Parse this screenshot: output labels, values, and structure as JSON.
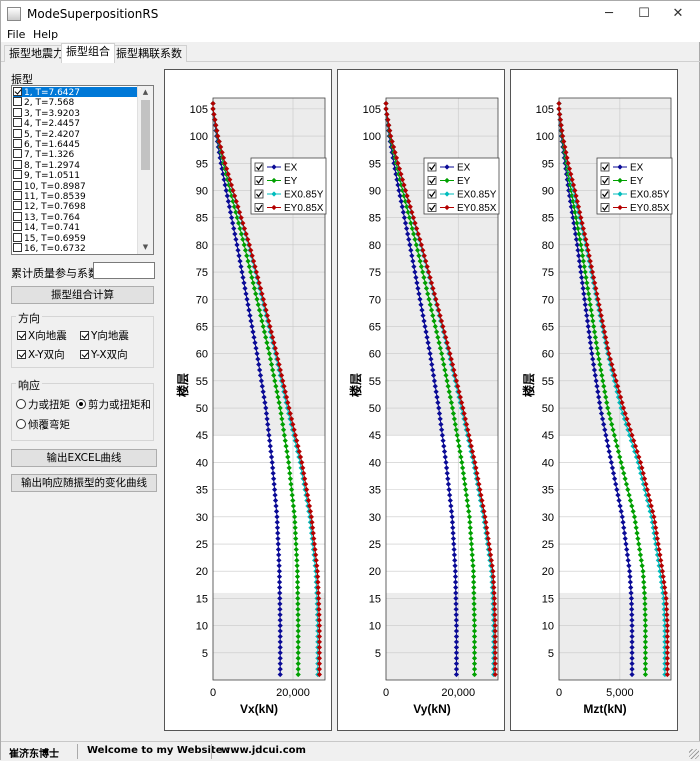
{
  "window": {
    "title": "ModeSuperpositionRS",
    "min_glyph": "─",
    "max_glyph": "☐",
    "close_glyph": "✕"
  },
  "menu": [
    "File",
    "Help"
  ],
  "tabs": [
    "振型地震力",
    "振型组合",
    "振型耦联系数"
  ],
  "active_tab": 1,
  "left": {
    "modes_label": "振型",
    "modes": [
      {
        "label": "1, T=7.6427",
        "checked": true,
        "selected": true
      },
      {
        "label": "2, T=7.568",
        "checked": false
      },
      {
        "label": "3, T=3.9203",
        "checked": false
      },
      {
        "label": "4, T=2.4457",
        "checked": false
      },
      {
        "label": "5, T=2.4207",
        "checked": false
      },
      {
        "label": "6, T=1.6445",
        "checked": false
      },
      {
        "label": "7, T=1.326",
        "checked": false
      },
      {
        "label": "8, T=1.2974",
        "checked": false
      },
      {
        "label": "9, T=1.0511",
        "checked": false
      },
      {
        "label": "10, T=0.8987",
        "checked": false
      },
      {
        "label": "11, T=0.8539",
        "checked": false
      },
      {
        "label": "12, T=0.7698",
        "checked": false
      },
      {
        "label": "13, T=0.764",
        "checked": false
      },
      {
        "label": "14, T=0.741",
        "checked": false
      },
      {
        "label": "15, T=0.6959",
        "checked": false
      },
      {
        "label": "16, T=0.6732",
        "checked": false
      }
    ],
    "mass_label": "累计质量参与系数",
    "mass_value": "",
    "calc_button": "振型组合计算",
    "direction": {
      "legend": "方向",
      "items": [
        {
          "label": "X向地震",
          "checked": true
        },
        {
          "label": "Y向地震",
          "checked": true
        },
        {
          "label": "X-Y双向",
          "checked": true
        },
        {
          "label": "Y-X双向",
          "checked": true
        }
      ]
    },
    "response": {
      "legend": "响应",
      "items": [
        {
          "label": "力或扭矩",
          "selected": false
        },
        {
          "label": "剪力或扭矩和",
          "selected": true
        },
        {
          "label": "倾覆弯矩",
          "selected": false
        }
      ]
    },
    "excel_button": "输出EXCEL曲线",
    "resp_button": "输出响应随振型的变化曲线"
  },
  "colors": {
    "EX": "#0a0a96",
    "EY": "#00a000",
    "EX0.85Y": "#00bcbc",
    "EY0.85X": "#b40000"
  },
  "chart_data": [
    {
      "type": "line",
      "ylabel": "楼层",
      "xlabel": "Vx(kN)",
      "ylim": [
        0,
        107
      ],
      "xlim": [
        0,
        28000
      ],
      "xticks": [
        0,
        20000
      ],
      "xtick_labels": [
        "0",
        "20,000"
      ],
      "yticks": [
        5,
        10,
        15,
        20,
        25,
        30,
        35,
        40,
        45,
        50,
        55,
        60,
        65,
        70,
        75,
        80,
        85,
        90,
        95,
        100,
        105
      ],
      "legend": [
        "EX",
        "EY",
        "EX0.85Y",
        "EY0.85X"
      ],
      "series": [
        {
          "name": "EX",
          "floors": [
            1,
            10,
            20,
            30,
            40,
            50,
            60,
            70,
            80,
            90,
            95,
            100,
            105
          ],
          "values": [
            16800,
            16800,
            16600,
            16000,
            14800,
            13200,
            11000,
            8500,
            6000,
            3300,
            2000,
            900,
            0
          ]
        },
        {
          "name": "EY",
          "floors": [
            1,
            10,
            20,
            30,
            40,
            50,
            60,
            70,
            80,
            90,
            95,
            100,
            105
          ],
          "values": [
            21300,
            21300,
            21100,
            20400,
            18900,
            16800,
            14100,
            11000,
            7800,
            4300,
            2600,
            1100,
            0
          ]
        },
        {
          "name": "EX0.85Y",
          "floors": [
            1,
            10,
            15,
            20,
            30,
            40,
            50,
            60,
            70,
            80,
            90,
            95,
            100,
            105
          ],
          "values": [
            26200,
            26200,
            26000,
            25700,
            24200,
            21800,
            18600,
            15600,
            12300,
            8900,
            4900,
            2900,
            1200,
            0
          ]
        },
        {
          "name": "EY0.85X",
          "floors": [
            1,
            10,
            15,
            20,
            30,
            40,
            50,
            60,
            70,
            80,
            90,
            95,
            100,
            105
          ],
          "values": [
            26600,
            26600,
            26400,
            26100,
            24600,
            22200,
            19000,
            15900,
            12600,
            9100,
            5000,
            3000,
            1200,
            0
          ]
        }
      ]
    },
    {
      "type": "line",
      "ylabel": "楼层",
      "xlabel": "Vy(kN)",
      "ylim": [
        0,
        107
      ],
      "xlim": [
        0,
        31000
      ],
      "xticks": [
        0,
        20000
      ],
      "xtick_labels": [
        "0",
        "20,000"
      ],
      "yticks": [
        5,
        10,
        15,
        20,
        25,
        30,
        35,
        40,
        45,
        50,
        55,
        60,
        65,
        70,
        75,
        80,
        85,
        90,
        95,
        100,
        105
      ],
      "legend": [
        "EX",
        "EY",
        "EX0.85Y",
        "EY0.85X"
      ],
      "series": [
        {
          "name": "EX",
          "floors": [
            1,
            10,
            20,
            30,
            40,
            50,
            60,
            70,
            80,
            90,
            95,
            100,
            105
          ],
          "values": [
            19500,
            19500,
            19200,
            18300,
            16600,
            14600,
            12200,
            9400,
            6600,
            3600,
            2200,
            900,
            0
          ]
        },
        {
          "name": "EY",
          "floors": [
            1,
            10,
            20,
            30,
            40,
            50,
            60,
            70,
            80,
            90,
            95,
            100,
            105
          ],
          "values": [
            24500,
            24500,
            24200,
            23100,
            21000,
            18400,
            15400,
            11900,
            8400,
            4600,
            2800,
            1100,
            0
          ]
        },
        {
          "name": "EX0.85Y",
          "floors": [
            1,
            10,
            15,
            20,
            30,
            40,
            50,
            60,
            70,
            80,
            90,
            95,
            100,
            105
          ],
          "values": [
            29800,
            29800,
            29600,
            29200,
            27000,
            24200,
            20900,
            17400,
            13600,
            9600,
            5300,
            3200,
            1300,
            0
          ]
        },
        {
          "name": "EY0.85X",
          "floors": [
            1,
            10,
            15,
            20,
            30,
            40,
            50,
            60,
            70,
            80,
            90,
            95,
            100,
            105
          ],
          "values": [
            30200,
            30200,
            30000,
            29600,
            27400,
            24600,
            21300,
            17700,
            13800,
            9800,
            5400,
            3300,
            1300,
            0
          ]
        }
      ]
    },
    {
      "type": "line",
      "ylabel": "楼层",
      "xlabel": "Mzt(kN)",
      "ylim": [
        0,
        107
      ],
      "xlim": [
        0,
        9200
      ],
      "xticks": [
        0,
        5000
      ],
      "xtick_labels": [
        "0",
        "5,000"
      ],
      "yticks": [
        5,
        10,
        15,
        20,
        25,
        30,
        35,
        40,
        45,
        50,
        55,
        60,
        65,
        70,
        75,
        80,
        85,
        90,
        95,
        100,
        105
      ],
      "legend": [
        "EX",
        "EY",
        "EX0.85Y",
        "EY0.85X"
      ],
      "series": [
        {
          "name": "EX",
          "floors": [
            1,
            10,
            15,
            20,
            30,
            40,
            50,
            60,
            70,
            80,
            90,
            95,
            100,
            105
          ],
          "values": [
            6000,
            6000,
            5950,
            5800,
            5200,
            4300,
            3400,
            2700,
            2100,
            1500,
            800,
            500,
            200,
            0
          ]
        },
        {
          "name": "EY",
          "floors": [
            1,
            10,
            15,
            20,
            30,
            40,
            50,
            60,
            70,
            80,
            90,
            95,
            100,
            105
          ],
          "values": [
            7100,
            7100,
            7050,
            6900,
            6200,
            5100,
            4000,
            3200,
            2500,
            1800,
            1000,
            600,
            250,
            0
          ]
        },
        {
          "name": "EX0.85Y",
          "floors": [
            1,
            10,
            15,
            20,
            30,
            40,
            50,
            60,
            70,
            80,
            90,
            95,
            100,
            105
          ],
          "values": [
            8700,
            8700,
            8600,
            8300,
            7600,
            6500,
            5100,
            4000,
            3100,
            2200,
            1200,
            700,
            300,
            0
          ]
        },
        {
          "name": "EY0.85X",
          "floors": [
            1,
            10,
            15,
            20,
            30,
            40,
            50,
            60,
            70,
            80,
            90,
            95,
            100,
            105
          ],
          "values": [
            8900,
            8900,
            8800,
            8500,
            7800,
            6700,
            5300,
            4100,
            3200,
            2300,
            1300,
            750,
            300,
            0
          ]
        }
      ]
    }
  ],
  "status": {
    "author": "崔济东博士",
    "welcome": "Welcome to my Website :",
    "website": "www.jdcui.com"
  }
}
